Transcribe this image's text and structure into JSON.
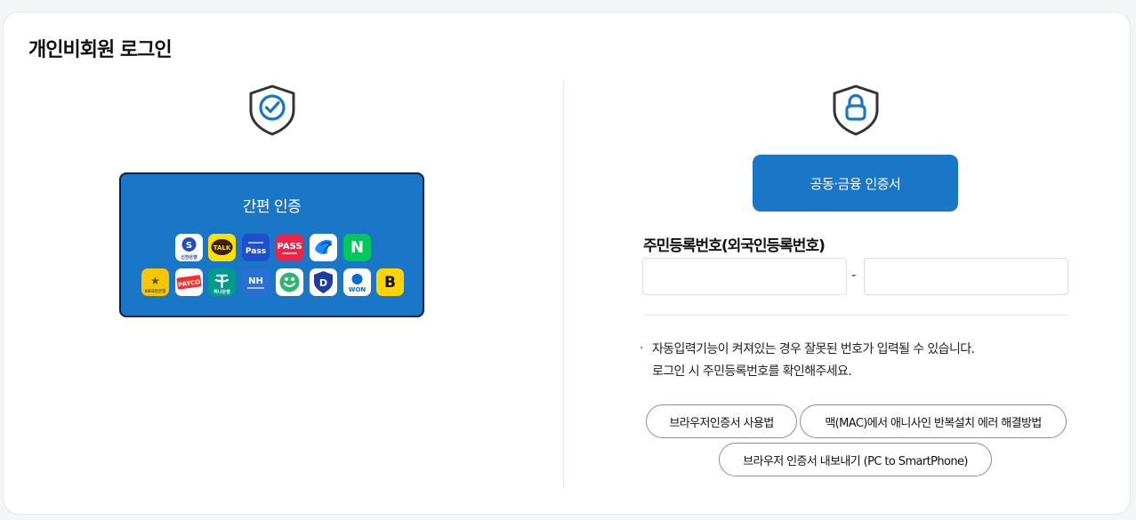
{
  "page": {
    "title": "개인비회원 로그인"
  },
  "easy_auth": {
    "title": "간편 인증",
    "apps": [
      {
        "name": "shinhan",
        "text": "신한은행",
        "bg": "#ffffff",
        "fg": "#1b3f9c"
      },
      {
        "name": "kakaotalk",
        "text": "TALK",
        "bg": "#fae100",
        "fg": "#3a1d1d"
      },
      {
        "name": "samsung-pass",
        "text": "Pass",
        "bg": "#1f4fcf",
        "fg": "#ffffff"
      },
      {
        "name": "pass",
        "text": "PASS",
        "bg": "#e8264a",
        "fg": "#ffffff"
      },
      {
        "name": "toss",
        "text": "",
        "bg": "#ffffff",
        "fg": "#1a8cff"
      },
      {
        "name": "naver",
        "text": "N",
        "bg": "#03c75a",
        "fg": "#ffffff"
      },
      {
        "name": "kb",
        "text": "KB국민은행",
        "bg": "#f7c600",
        "fg": "#5b4a2e"
      },
      {
        "name": "payco",
        "text": "PAYCO",
        "bg": "#ffffff",
        "fg": "#ff2a2a"
      },
      {
        "name": "hana",
        "text": "하나은행",
        "bg": "#009b8d",
        "fg": "#ffffff"
      },
      {
        "name": "nh",
        "text": "NH",
        "bg": "#2a6fd6",
        "fg": "#ffffff"
      },
      {
        "name": "woori",
        "text": "",
        "bg": "#ffffff",
        "fg": "#2bb673"
      },
      {
        "name": "d-sign",
        "text": "D",
        "bg": "#ffffff",
        "fg": "#1b3fa0"
      },
      {
        "name": "won",
        "text": "WON",
        "bg": "#ffffff",
        "fg": "#0a6cd1"
      },
      {
        "name": "banksalad",
        "text": "B",
        "bg": "#ffd400",
        "fg": "#111111"
      }
    ]
  },
  "certificate": {
    "button_label": "공동·금융 인증서"
  },
  "rrn": {
    "label": "주민등록번호(외국인등록번호)",
    "separator": "-",
    "front_value": "",
    "back_value": ""
  },
  "notice": {
    "bullet": "·",
    "lines": [
      "자동입력기능이 켜져있는 경우 잘못된 번호가 입력될 수 있습니다.",
      "로그인 시 주민등록번호를 확인해주세요."
    ]
  },
  "help_links": {
    "browser_cert_usage": "브라우저인증서 사용법",
    "mac_anysign_fix": "맥(MAC)에서 애니사인 반복설치 에러 해결방법",
    "browser_cert_export": "브라우저 인증서 내보내기 (PC to SmartPhone)"
  },
  "colors": {
    "brand": "#1a76c7",
    "icon_stroke": "#1a76c7",
    "shield_outline": "#333333"
  }
}
